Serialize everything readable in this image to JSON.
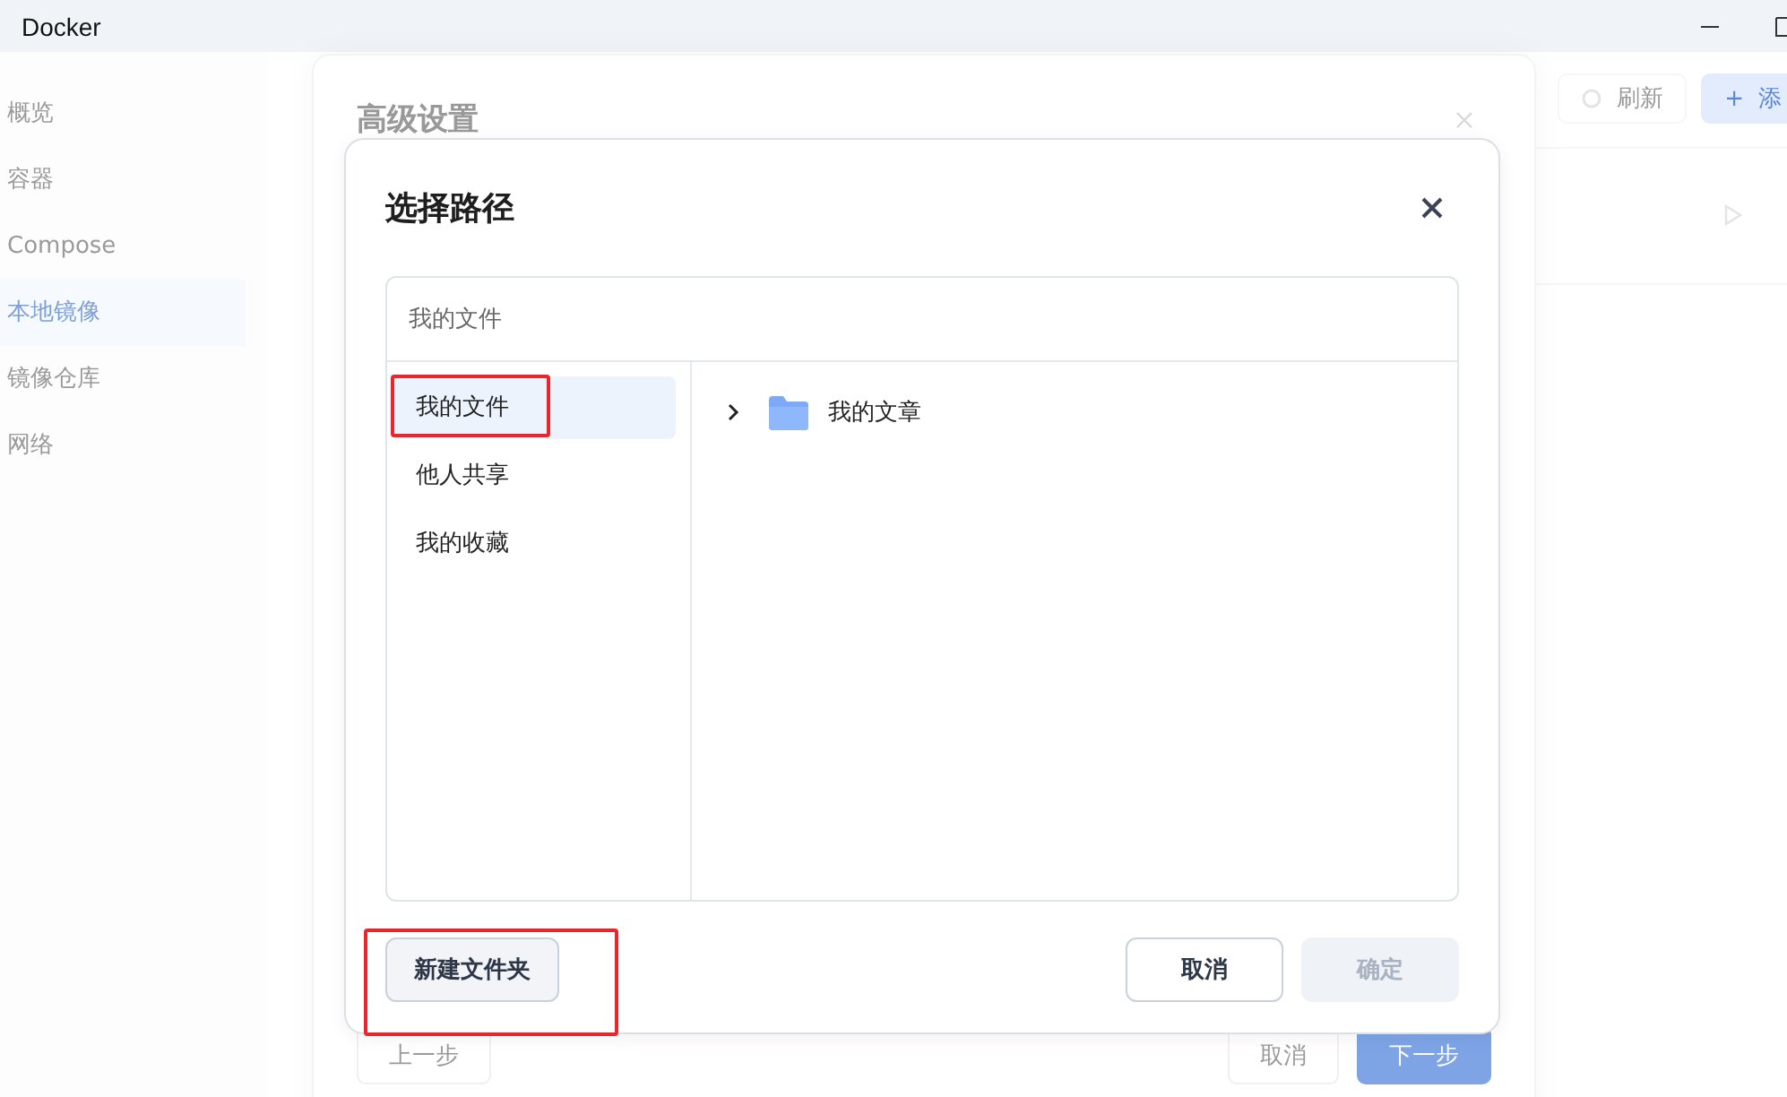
{
  "window": {
    "title": "Docker"
  },
  "sidebar": {
    "items": [
      {
        "label": "概览",
        "selected": false
      },
      {
        "label": "容器",
        "selected": false
      },
      {
        "label": "Compose",
        "selected": false
      },
      {
        "label": "本地镜像",
        "selected": true
      },
      {
        "label": "镜像仓库",
        "selected": false
      },
      {
        "label": "网络",
        "selected": false
      }
    ]
  },
  "page": {
    "toolbar": [
      {
        "label": "刷新",
        "kind": "default"
      },
      {
        "label": "添",
        "kind": "primary",
        "icon": "+"
      }
    ]
  },
  "background_dialog": {
    "title": "高级设置",
    "buttons": [
      {
        "label": "上一步",
        "kind": "default"
      },
      {
        "label": "取消",
        "kind": "default"
      },
      {
        "label": "下一步",
        "kind": "primary"
      }
    ]
  },
  "dialog": {
    "title": "选择路径",
    "path": "我的文件",
    "locations": [
      {
        "label": "我的文件",
        "selected": true,
        "highlighted": true
      },
      {
        "label": "他人共享",
        "selected": false,
        "highlighted": false
      },
      {
        "label": "我的收藏",
        "selected": false,
        "highlighted": false
      }
    ],
    "tree": [
      {
        "label": "我的文章",
        "expanded": false
      }
    ],
    "new_folder_button": {
      "label": "新建文件夹",
      "highlighted": true
    },
    "buttons": [
      {
        "label": "取消",
        "kind": "default",
        "disabled": false
      },
      {
        "label": "确定",
        "kind": "primary",
        "disabled": true
      }
    ]
  }
}
